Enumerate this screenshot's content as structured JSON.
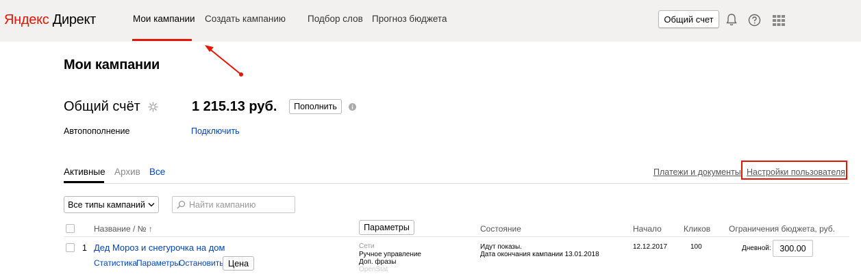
{
  "header": {
    "logo_ya": "Яндекс",
    "logo_rest": " Директ",
    "nav": {
      "my_campaigns": "Мои кампании",
      "create_campaign": "Создать кампанию",
      "word_selection": "Подбор слов",
      "budget_forecast": "Прогноз бюджета"
    },
    "account_button": "Общий счет",
    "icons": [
      "bell-icon",
      "help-icon",
      "apps-grid-icon"
    ]
  },
  "page": {
    "title": "Мои кампании"
  },
  "account": {
    "title": "Общий счёт",
    "amount": "1 215.13 руб.",
    "topup_button": "Пополнить",
    "autopay_label": "Автопополнение",
    "autopay_link": "Подключить"
  },
  "tabs": {
    "active": "Активные",
    "archive": "Архив",
    "all": "Все",
    "payments_link": "Платежи и документы",
    "user_settings_link": "Настройки пользователя"
  },
  "filters": {
    "campaign_type": "Все типы кампаний",
    "search_placeholder": "Найти кампанию"
  },
  "table": {
    "headers": {
      "name": "Название / № ↑",
      "params_button": "Параметры",
      "state": "Состояние",
      "start": "Начало",
      "clicks": "Кликов",
      "budget": "Ограничения бюджета, руб."
    },
    "rows": [
      {
        "index": "1",
        "name": "Дед Мороз и снегурочка на дом",
        "actions": {
          "stats": "Статистика",
          "params": "Параметры",
          "stop": "Остановить",
          "price_button": "Цена"
        },
        "strategy": {
          "networks": "Сети",
          "manual": "Ручное управление",
          "extra_phrases": "Доп. фразы",
          "openstat": "OpenStat"
        },
        "state_line1": "Идут показы.",
        "state_line2": "Дата окончания кампании 13.01.2018",
        "start": "12.12.2017",
        "clicks": "100",
        "budget_label": "Дневной:",
        "budget_value": "300.00"
      }
    ]
  },
  "colors": {
    "accent_red": "#e61400",
    "link_blue": "#0044bb",
    "header_bg": "#f2f1ef"
  }
}
